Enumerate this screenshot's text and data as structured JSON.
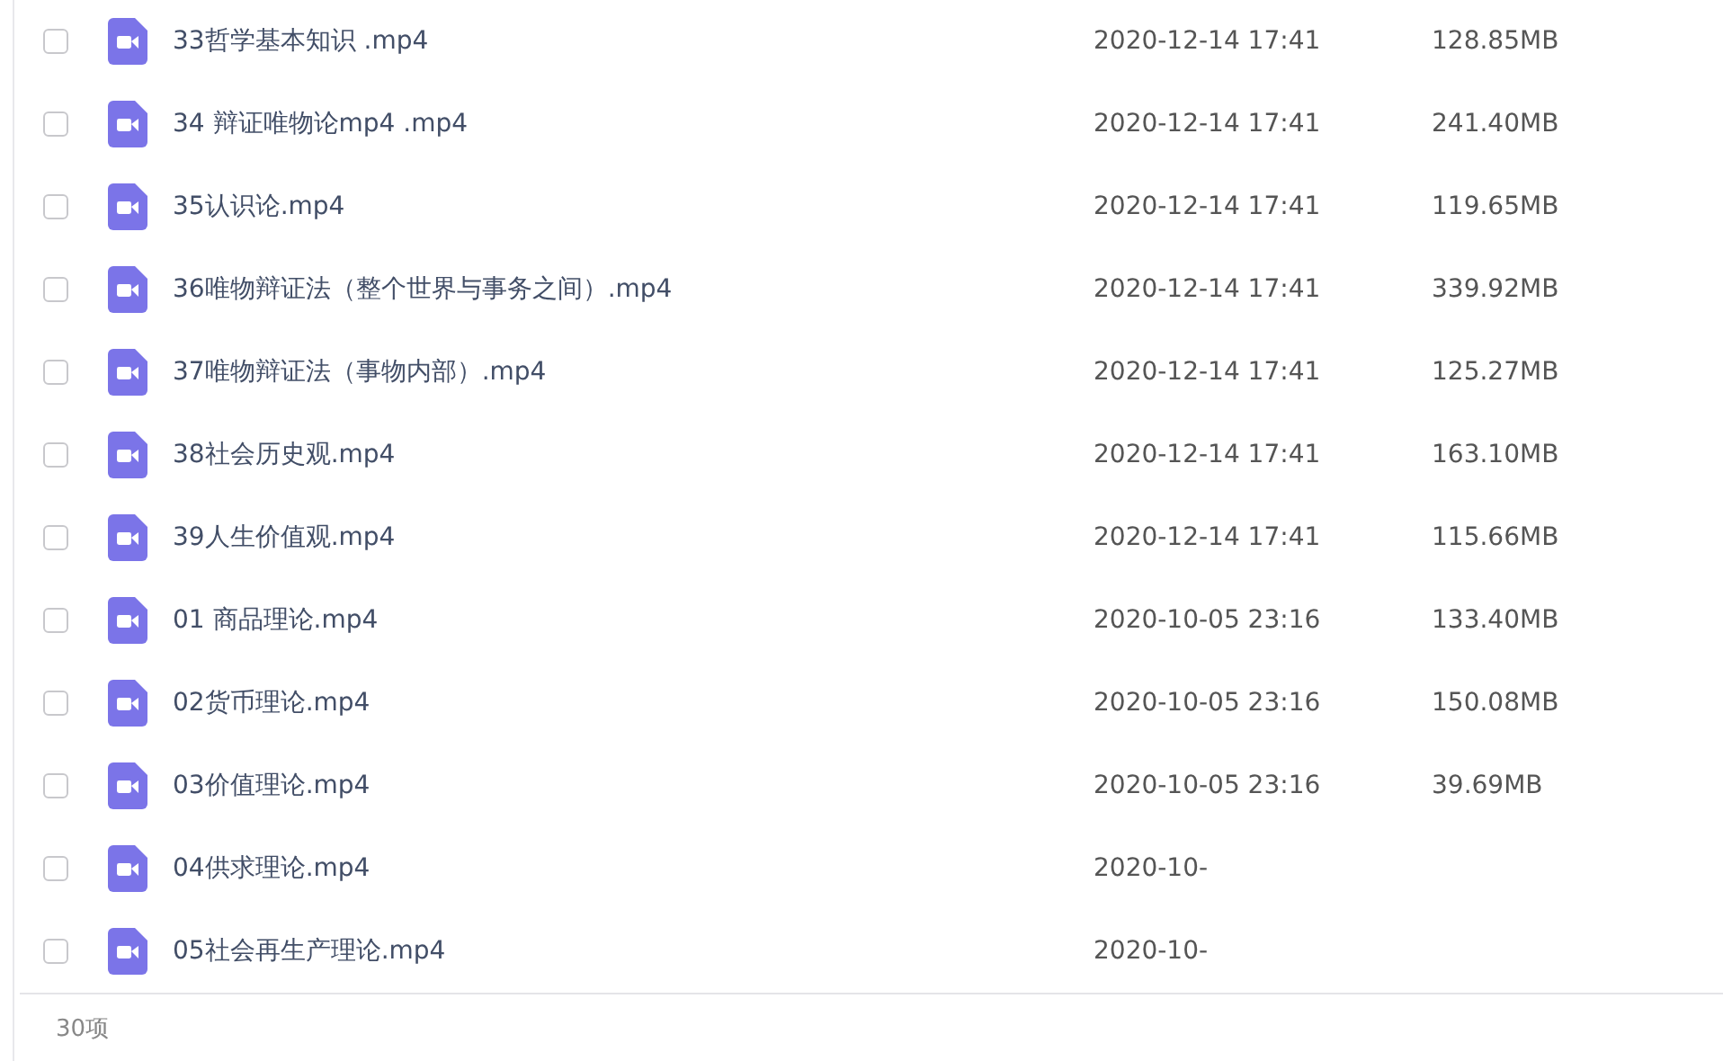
{
  "files": [
    {
      "name": "33哲学基本知识 .mp4",
      "date": "2020-12-14 17:41",
      "size": "128.85MB",
      "checked": false
    },
    {
      "name": "34 辩证唯物论mp4 .mp4",
      "date": "2020-12-14 17:41",
      "size": "241.40MB",
      "checked": false
    },
    {
      "name": "35认识论.mp4",
      "date": "2020-12-14 17:41",
      "size": "119.65MB",
      "checked": false
    },
    {
      "name": "36唯物辩证法（整个世界与事务之间）.mp4",
      "date": "2020-12-14 17:41",
      "size": "339.92MB",
      "checked": false
    },
    {
      "name": "37唯物辩证法（事物内部）.mp4",
      "date": "2020-12-14 17:41",
      "size": "125.27MB",
      "checked": false
    },
    {
      "name": "38社会历史观.mp4",
      "date": "2020-12-14 17:41",
      "size": "163.10MB",
      "checked": false
    },
    {
      "name": "39人生价值观.mp4",
      "date": "2020-12-14 17:41",
      "size": "115.66MB",
      "checked": false
    },
    {
      "name": "01 商品理论.mp4",
      "date": "2020-10-05 23:16",
      "size": "133.40MB",
      "checked": false
    },
    {
      "name": "02货币理论.mp4",
      "date": "2020-10-05 23:16",
      "size": "150.08MB",
      "checked": false
    },
    {
      "name": "03价值理论.mp4",
      "date": "2020-10-05 23:16",
      "size": "39.69MB",
      "checked": false
    },
    {
      "name": "04供求理论.mp4",
      "date": "2020-10-",
      "checked": false
    },
    {
      "name": "05社会再生产理论.mp4",
      "date": "2020-10-",
      "checked": false
    }
  ],
  "footer": {
    "count": "30项"
  }
}
